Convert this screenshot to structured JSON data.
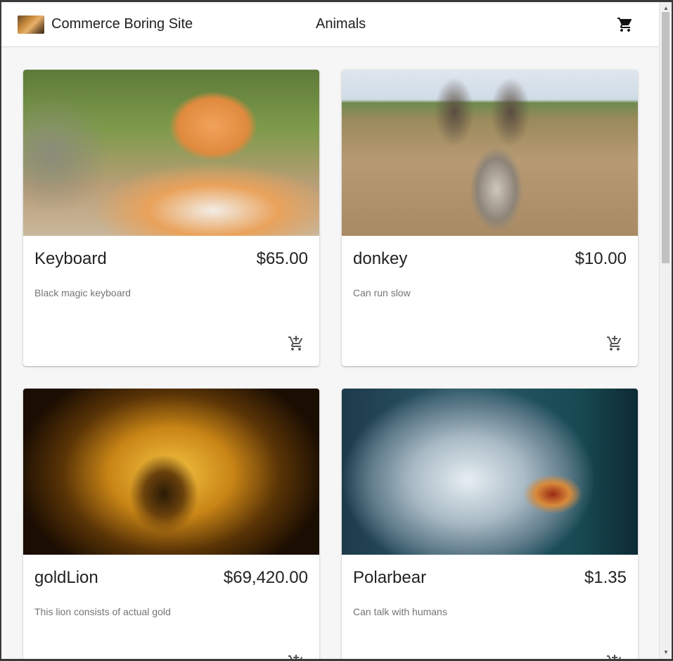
{
  "header": {
    "brand": "Commerce Boring Site",
    "nav_title": "Animals",
    "cart_icon": "shopping-cart-icon"
  },
  "products": [
    {
      "name": "Keyboard",
      "price": "$65.00",
      "description": "Black magic keyboard",
      "image": "cat-photo"
    },
    {
      "name": "donkey",
      "price": "$10.00",
      "description": "Can run slow",
      "image": "donkey-photo"
    },
    {
      "name": "goldLion",
      "price": "$69,420.00",
      "description": "This lion consists of actual gold",
      "image": "lion-photo"
    },
    {
      "name": "Polarbear",
      "price": "$1.35",
      "description": "Can talk with humans",
      "image": "polar-bear-photo"
    }
  ],
  "colors": {
    "appbar_bg": "#ffffff",
    "page_bg": "#f6f6f6",
    "text_primary": "#222222",
    "text_secondary": "#757575",
    "icon": "#555555"
  }
}
